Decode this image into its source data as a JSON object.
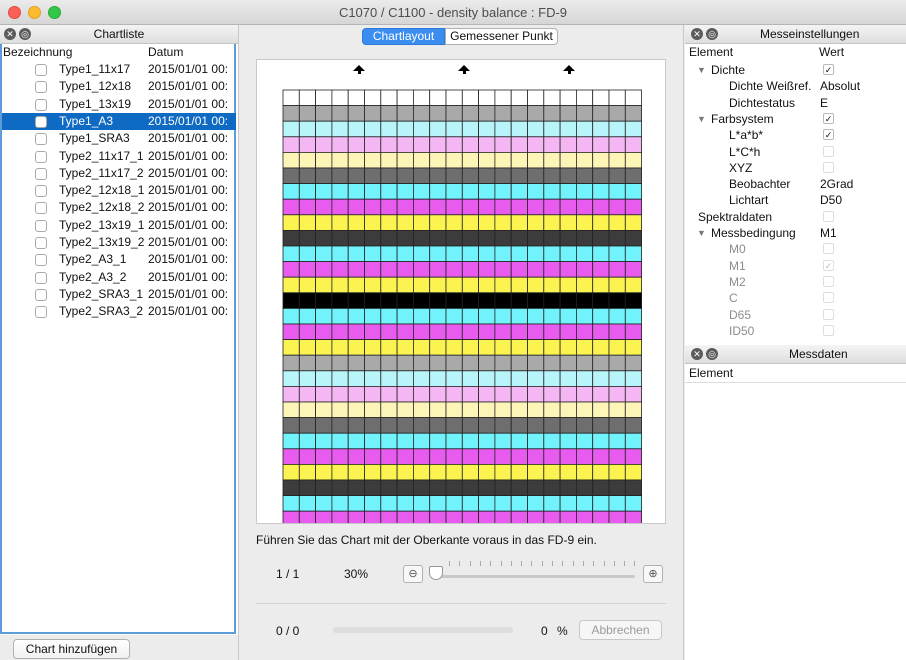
{
  "window": {
    "title": "C1070 / C1100 - density balance : FD-9"
  },
  "chartlist": {
    "title": "Chartliste",
    "col_name": "Bezeichnung",
    "col_date": "Datum",
    "rows": [
      {
        "name": "Type1_11x17",
        "date": "2015/01/01 00:"
      },
      {
        "name": "Type1_12x18",
        "date": "2015/01/01 00:"
      },
      {
        "name": "Type1_13x19",
        "date": "2015/01/01 00:"
      },
      {
        "name": "Type1_A3",
        "date": "2015/01/01 00:"
      },
      {
        "name": "Type1_SRA3",
        "date": "2015/01/01 00:"
      },
      {
        "name": "Type2_11x17_1",
        "date": "2015/01/01 00:"
      },
      {
        "name": "Type2_11x17_2",
        "date": "2015/01/01 00:"
      },
      {
        "name": "Type2_12x18_1",
        "date": "2015/01/01 00:"
      },
      {
        "name": "Type2_12x18_2",
        "date": "2015/01/01 00:"
      },
      {
        "name": "Type2_13x19_1",
        "date": "2015/01/01 00:"
      },
      {
        "name": "Type2_13x19_2",
        "date": "2015/01/01 00:"
      },
      {
        "name": "Type2_A3_1",
        "date": "2015/01/01 00:"
      },
      {
        "name": "Type2_A3_2",
        "date": "2015/01/01 00:"
      },
      {
        "name": "Type2_SRA3_1",
        "date": "2015/01/01 00:"
      },
      {
        "name": "Type2_SRA3_2",
        "date": "2015/01/01 00:"
      }
    ],
    "selected_index": 3,
    "add_button": "Chart hinzufügen"
  },
  "tabs": {
    "layout": "Chartlayout",
    "measured": "Gemessener Punkt"
  },
  "chart": {
    "columns": 22,
    "band_colors": [
      "#ffffff",
      "#a9a9a9",
      "#b7f5fb",
      "#f4b7f4",
      "#fdf5b8",
      "#6e6e6e",
      "#72f2fb",
      "#e75cef",
      "#fbf34f",
      "#3c3c3c",
      "#72f2fb",
      "#e75cef",
      "#fbf34f",
      "#000000",
      "#72f2fb",
      "#e75cef",
      "#fbf34f",
      "#a9a9a9",
      "#b7f5fb",
      "#f4b7f4",
      "#fdf5b8",
      "#6e6e6e",
      "#72f2fb",
      "#e75cef",
      "#fbf34f",
      "#3c3c3c",
      "#72f2fb",
      "#e75cef"
    ]
  },
  "instruction": "Führen Sie das Chart mit der Oberkante voraus in das FD-9 ein.",
  "pager": {
    "page": "1 / 1",
    "zoom": "30%",
    "zoom_level": 0
  },
  "progress": {
    "count": "0 / 0",
    "percent": "0",
    "percent_unit": "%",
    "value": 0,
    "cancel": "Abbrechen"
  },
  "settings": {
    "title": "Messeinstellungen",
    "col_element": "Element",
    "col_value": "Wert",
    "rows": [
      {
        "label": "Dichte",
        "value": "",
        "check": "on",
        "expander": true,
        "indent": 0,
        "dim": false
      },
      {
        "label": "Dichte Weißref.",
        "value": "Absolut",
        "check": "",
        "expander": false,
        "indent": 2,
        "dim": false
      },
      {
        "label": "Dichtestatus",
        "value": "E",
        "check": "",
        "expander": false,
        "indent": 2,
        "dim": false
      },
      {
        "label": "Farbsystem",
        "value": "",
        "check": "on",
        "expander": true,
        "indent": 0,
        "dim": false
      },
      {
        "label": "L*a*b*",
        "value": "",
        "check": "on",
        "expander": false,
        "indent": 2,
        "dim": false
      },
      {
        "label": "L*C*h",
        "value": "",
        "check": "off",
        "expander": false,
        "indent": 2,
        "dim": false
      },
      {
        "label": "XYZ",
        "value": "",
        "check": "off",
        "expander": false,
        "indent": 2,
        "dim": false
      },
      {
        "label": "Beobachter",
        "value": "2Grad",
        "check": "",
        "expander": false,
        "indent": 2,
        "dim": false
      },
      {
        "label": "Lichtart",
        "value": "D50",
        "check": "",
        "expander": false,
        "indent": 2,
        "dim": false
      },
      {
        "label": "Spektraldaten",
        "value": "",
        "check": "off",
        "expander": false,
        "indent": 0,
        "dim": false
      },
      {
        "label": "Messbedingung",
        "value": "M1",
        "check": "",
        "expander": true,
        "indent": 0,
        "dim": false
      },
      {
        "label": "M0",
        "value": "",
        "check": "off",
        "expander": false,
        "indent": 2,
        "dim": true
      },
      {
        "label": "M1",
        "value": "",
        "check": "on",
        "expander": false,
        "indent": 2,
        "dim": true
      },
      {
        "label": "M2",
        "value": "",
        "check": "off",
        "expander": false,
        "indent": 2,
        "dim": true
      },
      {
        "label": "C",
        "value": "",
        "check": "off",
        "expander": false,
        "indent": 2,
        "dim": true
      },
      {
        "label": "D65",
        "value": "",
        "check": "off",
        "expander": false,
        "indent": 2,
        "dim": true
      },
      {
        "label": "ID50",
        "value": "",
        "check": "off",
        "expander": false,
        "indent": 2,
        "dim": true
      }
    ]
  },
  "measure": {
    "title": "Messdaten",
    "col_element": "Element"
  },
  "icons": {
    "close": "close-icon",
    "detach": "detach-icon",
    "zoom_out": "zoom-out-icon",
    "zoom_in": "zoom-in-icon",
    "expander": "disclosure-triangle-icon",
    "arrow": "arrow-up-icon"
  }
}
